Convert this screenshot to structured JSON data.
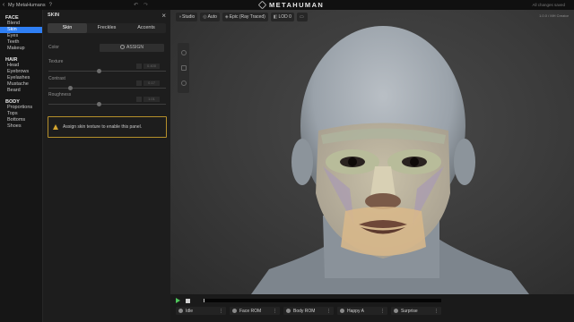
{
  "topbar": {
    "back_glyph": "‹",
    "title": "My MetaHumans",
    "help_glyph": "?",
    "undo_glyph": "↶",
    "redo_glyph": "↷",
    "brand": "METAHUMAN",
    "status": "All changes saved"
  },
  "nav": {
    "groups": [
      {
        "label": "FACE",
        "items": [
          "Blend",
          "Skin",
          "Eyes",
          "Teeth",
          "Makeup"
        ]
      },
      {
        "label": "HAIR",
        "items": [
          "Head",
          "Eyebrows",
          "Eyelashes",
          "Mustache",
          "Beard"
        ]
      },
      {
        "label": "BODY",
        "items": [
          "Proportions",
          "Tops",
          "Bottoms",
          "Shoes"
        ]
      }
    ],
    "active_item": "Skin"
  },
  "panel": {
    "title": "SKIN",
    "close_glyph": "×",
    "tabs": [
      "Skin",
      "Freckles",
      "Accents"
    ],
    "active_tab": "Skin",
    "color_label": "Color",
    "assign_label": "ASSIGN",
    "sliders": [
      {
        "label": "Texture",
        "value": "0.400",
        "level": 0.44
      },
      {
        "label": "Contrast",
        "value": "0.17",
        "level": 0.17
      },
      {
        "label": "Roughness",
        "value": "1.01",
        "level": 0.44
      }
    ],
    "warning": "Assign skin texture to enable this panel."
  },
  "viewport": {
    "chips": [
      {
        "icon": "lighting-icon",
        "glyph": "◑",
        "label": "Studio"
      },
      {
        "icon": "camera-icon",
        "glyph": "◎",
        "label": "Auto"
      },
      {
        "icon": "render-icon",
        "glyph": "◈",
        "label": "Epic (Ray Traced)"
      },
      {
        "icon": "lod-icon",
        "glyph": "◧",
        "label": "LOD 0"
      },
      {
        "icon": "screen-icon",
        "glyph": "▭",
        "label": ""
      }
    ],
    "version": "1.0.0 / MH Creator"
  },
  "playback": {
    "animations": [
      "Idle",
      "Face ROM",
      "Body ROM",
      "Happy A",
      "Surprise"
    ]
  },
  "colors": {
    "accent": "#2f7ff4",
    "warning": "#d4a52e",
    "play": "#4ec65b"
  }
}
